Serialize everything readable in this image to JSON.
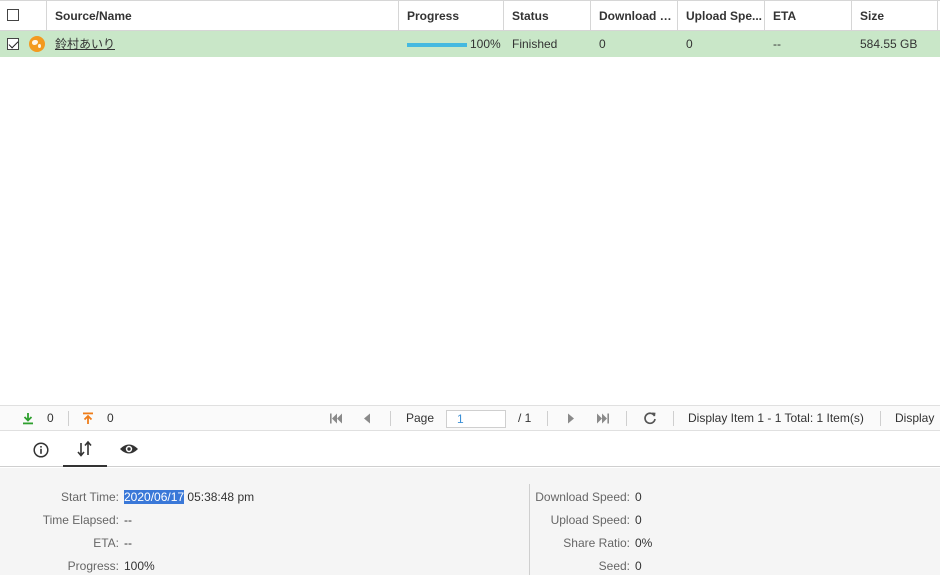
{
  "table": {
    "columns": [
      "Source/Name",
      "Progress",
      "Status",
      "Download S...",
      "Upload Spe...",
      "ETA",
      "Size"
    ],
    "rows": [
      {
        "checked": true,
        "icon": "globe-icon",
        "name": "鈴村あいり",
        "progress_value": 100,
        "progress_text": "100%",
        "status": "Finished",
        "download_speed": "0",
        "upload_speed": "0",
        "eta": "--",
        "size": "584.55 GB"
      }
    ]
  },
  "pager": {
    "download_count": "0",
    "upload_count": "0",
    "page_label": "Page",
    "page_value": "1",
    "page_total": "/ 1",
    "display_summary": "Display Item 1 - 1 Total: 1 Item(s)",
    "display_label": "Display"
  },
  "tabs": [
    "info-icon",
    "transfer-icon",
    "eye-icon"
  ],
  "details": {
    "left": [
      {
        "label": "Start Time:",
        "value_date": "2020/06/17",
        "value_time": " 05:38:48 pm"
      },
      {
        "label": "Time Elapsed:",
        "value": "--"
      },
      {
        "label": "ETA:",
        "value": "--"
      },
      {
        "label": "Progress:",
        "value": "100%"
      }
    ],
    "right": [
      {
        "label": "Download Speed:",
        "value": "0"
      },
      {
        "label": "Upload Speed:",
        "value": "0"
      },
      {
        "label": "Share Ratio:",
        "value": "0%"
      },
      {
        "label": "Seed:",
        "value": "0"
      }
    ]
  },
  "colors": {
    "row_selected": "#c9e7c8",
    "progress_fill": "#45b9e0",
    "download_arrow": "#2ea02e",
    "upload_arrow": "#ef7d1a",
    "selection_highlight": "#3a78d8"
  }
}
